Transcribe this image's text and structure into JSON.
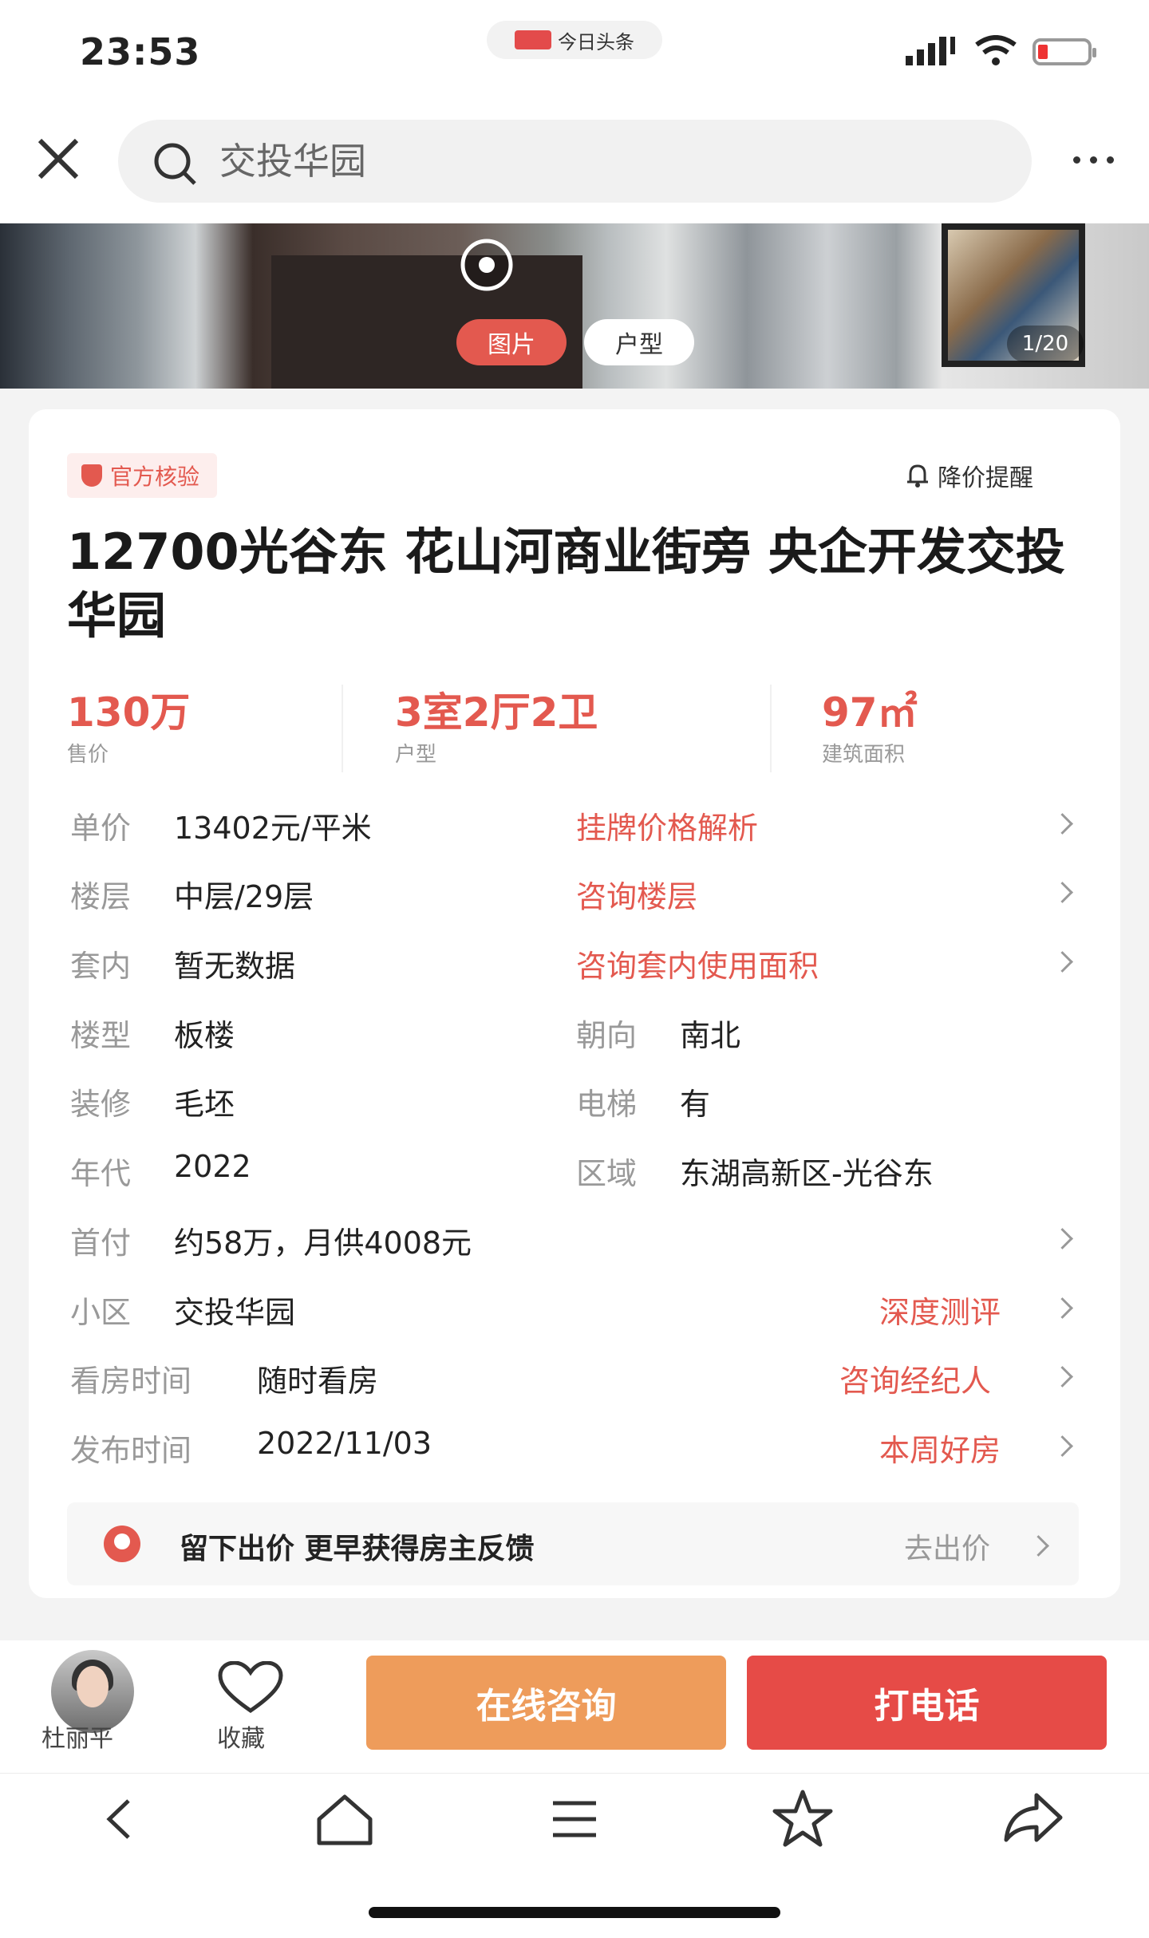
{
  "status_bar": {
    "time": "23:53",
    "app_badge": "今日头条"
  },
  "search": {
    "query": "交投华园"
  },
  "gallery": {
    "tabs": [
      "图片",
      "户型"
    ],
    "counter": "1/20"
  },
  "listing": {
    "verified_label": "官方核验",
    "price_alert_label": "降价提醒",
    "title": "12700光谷东 花山河商业街旁 央企开发交投华园",
    "stats": [
      {
        "value": "130万",
        "label": "售价"
      },
      {
        "value": "3室2厅2卫",
        "label": "户型"
      },
      {
        "value": "97㎡",
        "label": "建筑面积"
      }
    ],
    "details": [
      {
        "label": "单价",
        "value": "13402元/平米",
        "link": "挂牌价格解析"
      },
      {
        "label": "楼层",
        "value": "中层/29层",
        "link": "咨询楼层"
      },
      {
        "label": "套内",
        "value": "暂无数据",
        "link": "咨询套内使用面积"
      }
    ],
    "pairs": [
      {
        "label": "楼型",
        "value": "板楼",
        "label2": "朝向",
        "value2": "南北"
      },
      {
        "label": "装修",
        "value": "毛坯",
        "label2": "电梯",
        "value2": "有"
      },
      {
        "label": "年代",
        "value": "2022",
        "label2": "区域",
        "value2": "东湖高新区-光谷东"
      }
    ],
    "payment": {
      "label": "首付",
      "value": "约58万，月供4008元"
    },
    "links": [
      {
        "label": "小区",
        "value": "交投华园",
        "link": "深度测评"
      },
      {
        "label": "看房时间",
        "value": "随时看房",
        "link": "咨询经纪人"
      },
      {
        "label": "发布时间",
        "value": "2022/11/03",
        "link": "本周好房"
      }
    ],
    "offer": {
      "text": "留下出价 更早获得房主反馈",
      "link": "去出价"
    }
  },
  "actions": {
    "agent_name": "杜丽平",
    "favorite_label": "收藏",
    "consult_label": "在线咨询",
    "call_label": "打电话"
  },
  "colors": {
    "accent": "#e3594f",
    "consult": "#ee9c5b",
    "call": "#e64b47"
  }
}
